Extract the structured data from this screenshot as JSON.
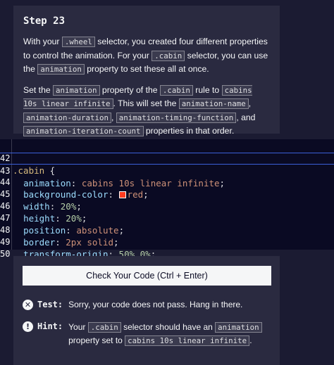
{
  "step": {
    "title": "Step 23"
  },
  "instructions": {
    "p1": {
      "t1": "With your ",
      "c1": ".wheel",
      "t2": " selector, you created four different properties to control the animation. For your ",
      "c2": ".cabin",
      "t3": " selector, you can use the ",
      "c3": "animation",
      "t4": " property to set these all at once."
    },
    "p2": {
      "t1": "Set the ",
      "c1": "animation",
      "t2": " property of the ",
      "c2": ".cabin",
      "t3": " rule to ",
      "c3": "cabins 10s linear infinite",
      "t4": ". This will set the ",
      "c4": "animation-name",
      "t5": ", ",
      "c5": "animation-duration",
      "t6": ", ",
      "c6": "animation-timing-function",
      "t7": ", and ",
      "c7": "animation-iteration-count",
      "t8": " properties in that order."
    }
  },
  "editor": {
    "lines": [
      {
        "n": "42",
        "sel": ".cabin",
        "brace": " {"
      },
      {
        "n": "43",
        "prop": "animation",
        "val": "cabins 10s linear infinite"
      },
      {
        "n": "44",
        "prop": "background-color",
        "val": "red",
        "swatch": "#ff0000"
      },
      {
        "n": "45",
        "prop": "width",
        "val": "20%"
      },
      {
        "n": "46",
        "prop": "height",
        "val": "20%"
      },
      {
        "n": "47",
        "prop": "position",
        "val": "absolute"
      },
      {
        "n": "48",
        "prop": "border",
        "val": "2px solid"
      },
      {
        "n": "49",
        "prop": "transform-origin",
        "val": "50% 0%"
      },
      {
        "n": "50",
        "brace": "}"
      }
    ]
  },
  "actions": {
    "check_label": "Check Your Code (Ctrl + Enter)"
  },
  "test": {
    "icon": "x-circle-icon",
    "label": "Test:",
    "message": "Sorry, your code does not pass. Hang in there."
  },
  "hint": {
    "icon": "lightbulb-icon",
    "label": "Hint:",
    "t1": "Your ",
    "c1": ".cabin",
    "t2": " selector should have an ",
    "c2": "animation",
    "t3": " property set to ",
    "c3": "cabins 10s linear infinite",
    "t4": "."
  }
}
